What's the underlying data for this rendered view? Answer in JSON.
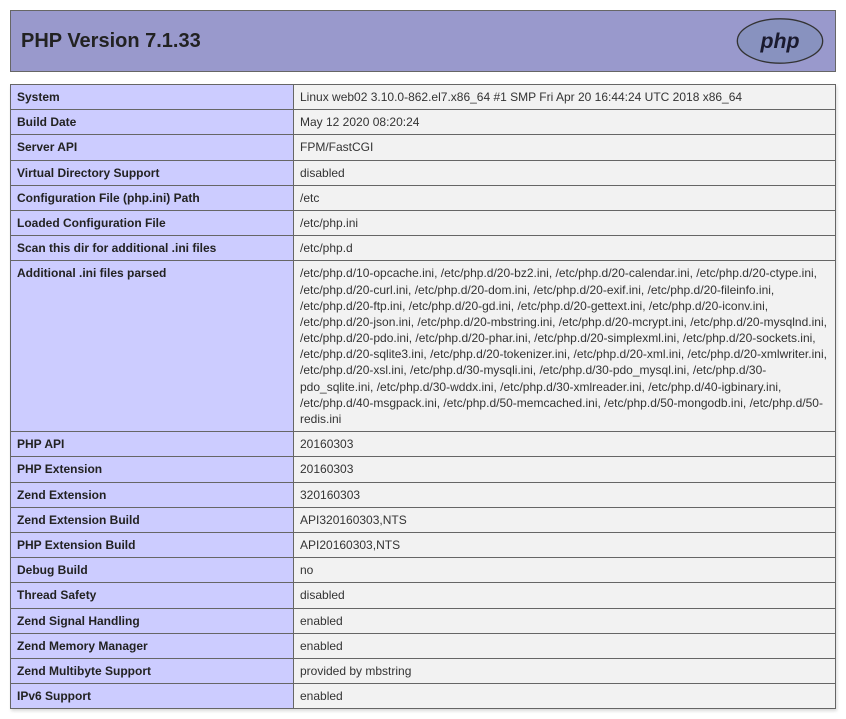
{
  "header": {
    "title": "PHP Version 7.1.33"
  },
  "rows": [
    {
      "label": "System",
      "value": "Linux web02 3.10.0-862.el7.x86_64 #1 SMP Fri Apr 20 16:44:24 UTC 2018 x86_64"
    },
    {
      "label": "Build Date",
      "value": "May 12 2020 08:20:24"
    },
    {
      "label": "Server API",
      "value": "FPM/FastCGI"
    },
    {
      "label": "Virtual Directory Support",
      "value": "disabled"
    },
    {
      "label": "Configuration File (php.ini) Path",
      "value": "/etc"
    },
    {
      "label": "Loaded Configuration File",
      "value": "/etc/php.ini"
    },
    {
      "label": "Scan this dir for additional .ini files",
      "value": "/etc/php.d"
    },
    {
      "label": "Additional .ini files parsed",
      "value": "/etc/php.d/10-opcache.ini, /etc/php.d/20-bz2.ini, /etc/php.d/20-calendar.ini, /etc/php.d/20-ctype.ini, /etc/php.d/20-curl.ini, /etc/php.d/20-dom.ini, /etc/php.d/20-exif.ini, /etc/php.d/20-fileinfo.ini, /etc/php.d/20-ftp.ini, /etc/php.d/20-gd.ini, /etc/php.d/20-gettext.ini, /etc/php.d/20-iconv.ini, /etc/php.d/20-json.ini, /etc/php.d/20-mbstring.ini, /etc/php.d/20-mcrypt.ini, /etc/php.d/20-mysqlnd.ini, /etc/php.d/20-pdo.ini, /etc/php.d/20-phar.ini, /etc/php.d/20-simplexml.ini, /etc/php.d/20-sockets.ini, /etc/php.d/20-sqlite3.ini, /etc/php.d/20-tokenizer.ini, /etc/php.d/20-xml.ini, /etc/php.d/20-xmlwriter.ini, /etc/php.d/20-xsl.ini, /etc/php.d/30-mysqli.ini, /etc/php.d/30-pdo_mysql.ini, /etc/php.d/30-pdo_sqlite.ini, /etc/php.d/30-wddx.ini, /etc/php.d/30-xmlreader.ini, /etc/php.d/40-igbinary.ini, /etc/php.d/40-msgpack.ini, /etc/php.d/50-memcached.ini, /etc/php.d/50-mongodb.ini, /etc/php.d/50-redis.ini"
    },
    {
      "label": "PHP API",
      "value": "20160303"
    },
    {
      "label": "PHP Extension",
      "value": "20160303"
    },
    {
      "label": "Zend Extension",
      "value": "320160303"
    },
    {
      "label": "Zend Extension Build",
      "value": "API320160303,NTS"
    },
    {
      "label": "PHP Extension Build",
      "value": "API20160303,NTS"
    },
    {
      "label": "Debug Build",
      "value": "no"
    },
    {
      "label": "Thread Safety",
      "value": "disabled"
    },
    {
      "label": "Zend Signal Handling",
      "value": "enabled"
    },
    {
      "label": "Zend Memory Manager",
      "value": "enabled"
    },
    {
      "label": "Zend Multibyte Support",
      "value": "provided by mbstring"
    },
    {
      "label": "IPv6 Support",
      "value": "enabled"
    }
  ]
}
